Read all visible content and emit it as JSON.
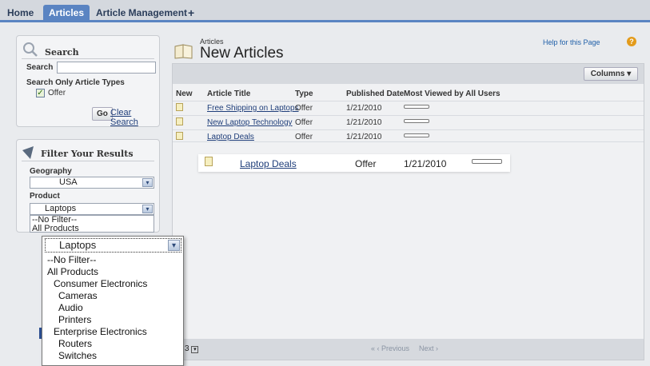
{
  "tabs": [
    {
      "label": "Home"
    },
    {
      "label": "Articles",
      "active": true
    },
    {
      "label": "Article Management"
    },
    {
      "label": "+"
    }
  ],
  "sidebar": {
    "search": {
      "title": "Search",
      "field_label": "Search",
      "only_types_label": "Search Only Article Types",
      "type_option": "Offer",
      "go_label": "Go",
      "clear_label": "Clear Search"
    },
    "filter": {
      "title": "Filter Your Results",
      "geography_label": "Geography",
      "geography_value": "USA",
      "product_label": "Product",
      "product_value": "Laptops",
      "product_options_small": [
        "--No Filter--",
        "All Products"
      ]
    }
  },
  "main": {
    "breadcrumb": "Articles",
    "title": "New Articles",
    "help_link": "Help for this Page",
    "columns_button": "Columns",
    "headers": [
      "New",
      "Article Title",
      "Type",
      "Published Date",
      "Most Viewed by All Users"
    ],
    "rows": [
      {
        "title": "Free Shipping on Laptops",
        "type": "Offer",
        "date": "1/21/2010"
      },
      {
        "title": "New Laptop Technology",
        "type": "Offer",
        "date": "1/21/2010"
      },
      {
        "title": "Laptop Deals",
        "type": "Offer",
        "date": "1/21/2010"
      }
    ],
    "zoom_row": {
      "title": "Laptop Deals",
      "type": "Offer",
      "date": "1/21/2010"
    },
    "pager": {
      "page_select": "3",
      "prev": "« ‹ Previous",
      "next": "Next ›"
    }
  },
  "big_dropdown": {
    "selected": "Laptops",
    "options": [
      {
        "label": "--No Filter--",
        "level": 0
      },
      {
        "label": "All Products",
        "level": 0
      },
      {
        "label": "Consumer Electronics",
        "level": 1
      },
      {
        "label": "Cameras",
        "level": 2
      },
      {
        "label": "Audio",
        "level": 2
      },
      {
        "label": "Printers",
        "level": 2
      },
      {
        "label": "Enterprise Electronics",
        "level": 1
      },
      {
        "label": "Routers",
        "level": 2
      },
      {
        "label": "Switches",
        "level": 2
      }
    ]
  },
  "colors": {
    "tab_active": "#5a84c2",
    "link": "#1f3e7a",
    "help_icon": "#e39b1b"
  }
}
